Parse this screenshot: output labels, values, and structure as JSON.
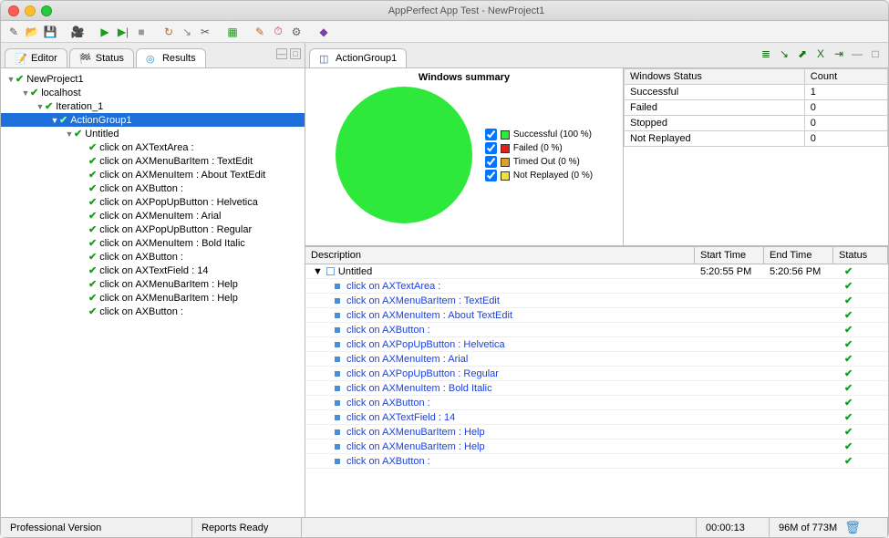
{
  "window": {
    "title": "AppPerfect App Test - NewProject1"
  },
  "left_tabs": {
    "editor": "Editor",
    "status": "Status",
    "results": "Results"
  },
  "right_tabs": {
    "group": "ActionGroup1"
  },
  "tree": {
    "root": "NewProject1",
    "host": "localhost",
    "iter": "Iteration_1",
    "group": "ActionGroup1",
    "untitled": "Untitled",
    "events": [
      "click on AXTextArea :",
      "click on AXMenuBarItem : TextEdit",
      "click on AXMenuItem : About TextEdit",
      "click on AXButton :",
      "click on AXPopUpButton : Helvetica",
      "click on AXMenuItem : Arial",
      "click on AXPopUpButton : Regular",
      "click on AXMenuItem : Bold Italic",
      "click on AXButton :",
      "click on AXTextField : 14",
      "click on AXMenuBarItem : Help",
      "click on AXMenuBarItem : Help",
      "click on AXButton :"
    ]
  },
  "chart_data": {
    "type": "pie",
    "title": "Windows summary",
    "series": [
      {
        "name": "Successful",
        "pct": 100,
        "color": "#2ee93b"
      },
      {
        "name": "Failed",
        "pct": 0,
        "color": "#e02020"
      },
      {
        "name": "Timed Out",
        "pct": 0,
        "color": "#e0a020"
      },
      {
        "name": "Not Replayed",
        "pct": 0,
        "color": "#f0e040"
      }
    ],
    "legend": {
      "successful": "Successful (100 %)",
      "failed": "Failed (0 %)",
      "timedout": "Timed Out (0 %)",
      "notreplayed": "Not Replayed (0 %)"
    }
  },
  "stats": {
    "head1": "Windows Status",
    "head2": "Count",
    "rows": [
      {
        "label": "Successful",
        "count": "1"
      },
      {
        "label": "Failed",
        "count": "0"
      },
      {
        "label": "Stopped",
        "count": "0"
      },
      {
        "label": "Not Replayed",
        "count": "0"
      }
    ]
  },
  "grid": {
    "head": {
      "desc": "Description",
      "start": "Start Time",
      "end": "End Time",
      "status": "Status"
    },
    "parent": {
      "desc": "Untitled",
      "start": "5:20:55 PM",
      "end": "5:20:56 PM"
    },
    "rows": [
      "click on AXTextArea :",
      "click on AXMenuBarItem : TextEdit",
      "click on AXMenuItem : About TextEdit",
      "click on AXButton :",
      "click on AXPopUpButton : Helvetica",
      "click on AXMenuItem : Arial",
      "click on AXPopUpButton : Regular",
      "click on AXMenuItem : Bold Italic",
      "click on AXButton :",
      "click on AXTextField : 14",
      "click on AXMenuBarItem : Help",
      "click on AXMenuBarItem : Help",
      "click on AXButton :"
    ]
  },
  "status": {
    "version": "Professional Version",
    "reports": "Reports Ready",
    "time": "00:00:13",
    "memory": "96M of 773M"
  }
}
